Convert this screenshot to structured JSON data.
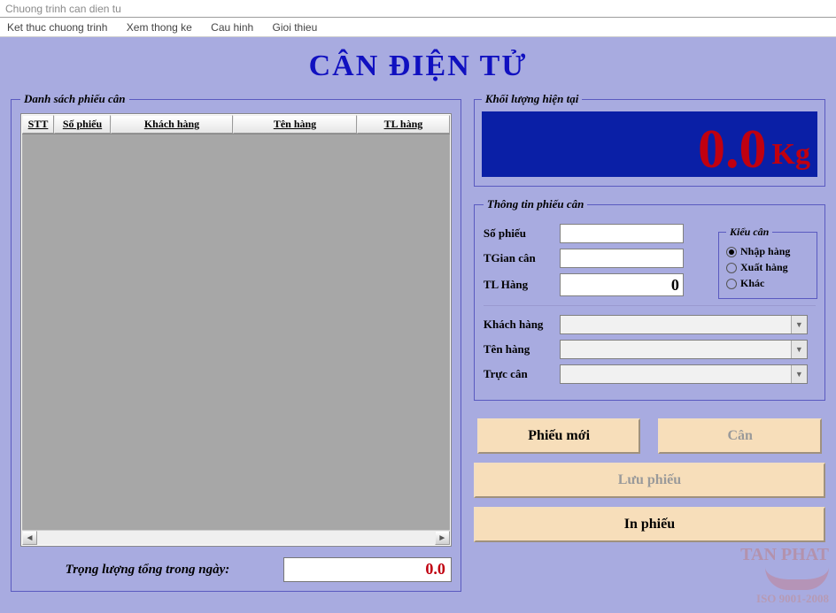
{
  "window_title": "Chuong trinh can dien tu",
  "menu": [
    "Ket thuc chuong trinh",
    "Xem thong ke",
    "Cau hinh",
    "Gioi thieu"
  ],
  "app_title": "CÂN ĐIỆN TỬ",
  "left": {
    "legend": "Danh sách phiếu cân",
    "columns": [
      "STT",
      "Số phiếu",
      "Khách hàng",
      "Tên hàng",
      "TL hàng"
    ],
    "rows": [],
    "total_label": "Trọng lượng tổng trong ngày:",
    "total_value": "0.0"
  },
  "weight": {
    "legend": "Khối lượng hiện tại",
    "value": "0.0",
    "unit": "Kg"
  },
  "form": {
    "legend": "Thông tin phiếu cân",
    "so_phieu_label": "Số phiếu",
    "so_phieu": "",
    "tgian_label": "TGian cân",
    "tgian": "",
    "tl_label": "TL Hàng",
    "tl_value": "0",
    "radio_legend": "Kiểu cân",
    "radio": [
      {
        "label": "Nhập hàng",
        "checked": true
      },
      {
        "label": "Xuất hàng",
        "checked": false
      },
      {
        "label": "Khác",
        "checked": false
      }
    ],
    "kh_label": "Khách hàng",
    "th_label": "Tên hàng",
    "tc_label": "Trực cân"
  },
  "buttons": {
    "new": "Phiếu mới",
    "weigh": "Cân",
    "save": "Lưu phiếu",
    "print": "In phiếu"
  },
  "watermark": {
    "l1": "TAN PHAT",
    "l2": "ISO 9001-2008"
  }
}
